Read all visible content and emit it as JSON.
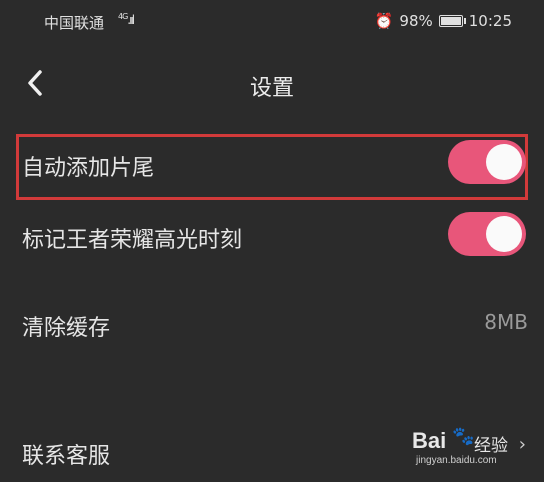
{
  "status_bar": {
    "carrier": "中国联通",
    "network": "4G",
    "battery_percent": "98%",
    "battery_level": 0.98,
    "time": "10:25"
  },
  "header": {
    "title": "设置"
  },
  "settings": [
    {
      "label": "自动添加片尾",
      "type": "toggle",
      "on": true
    },
    {
      "label": "标记王者荣耀高光时刻",
      "type": "toggle",
      "on": true
    },
    {
      "label": "清除缓存",
      "type": "value",
      "value": "8MB"
    },
    {
      "label": "联系客服",
      "type": "link"
    }
  ],
  "watermark": {
    "brand": "Bai",
    "brand_suffix": "经验",
    "url": "jingyan.baidu.com"
  },
  "colors": {
    "background": "#2b2b2b",
    "toggle_on": "#e8567a",
    "highlight": "#d23a3a"
  }
}
